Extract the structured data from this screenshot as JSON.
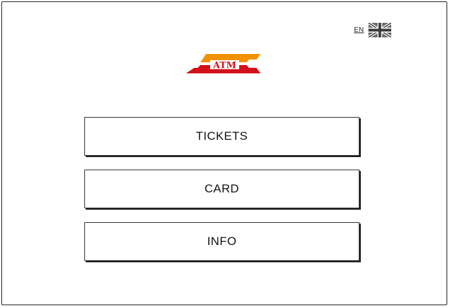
{
  "language": {
    "code": "EN",
    "flag_icon": "uk-flag-icon"
  },
  "logo": {
    "text": "ATM",
    "colors": {
      "orange": "#F39200",
      "red": "#D2111A",
      "text": "#D2111A"
    }
  },
  "menu": {
    "items": [
      {
        "label": "TICKETS"
      },
      {
        "label": "CARD"
      },
      {
        "label": "INFO"
      }
    ]
  }
}
